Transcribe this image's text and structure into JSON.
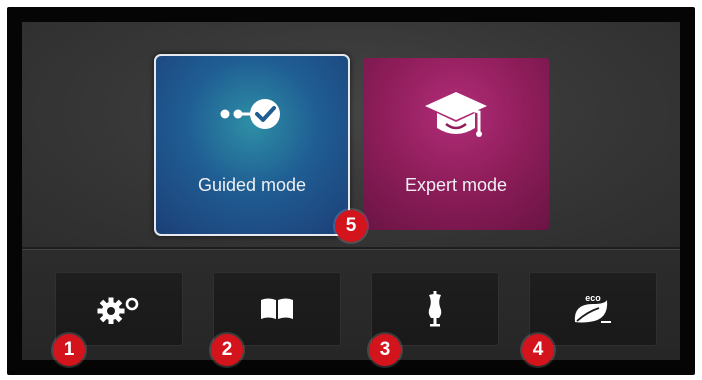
{
  "modes": {
    "guided": {
      "label": "Guided mode",
      "icon": "guided-steps-icon",
      "selected": true
    },
    "expert": {
      "label": "Expert mode",
      "icon": "graduation-cap-icon",
      "selected": false
    }
  },
  "toolbar": [
    {
      "icon": "settings-gears-icon"
    },
    {
      "icon": "book-icon"
    },
    {
      "icon": "dress-form-icon"
    },
    {
      "icon": "eco-leaf-icon",
      "icon_text": "eco"
    }
  ],
  "callouts": [
    "1",
    "2",
    "3",
    "4",
    "5"
  ],
  "colors": {
    "guided_tile": "#1f5d93",
    "expert_tile": "#8e1d5a",
    "badge": "#d3141c"
  }
}
